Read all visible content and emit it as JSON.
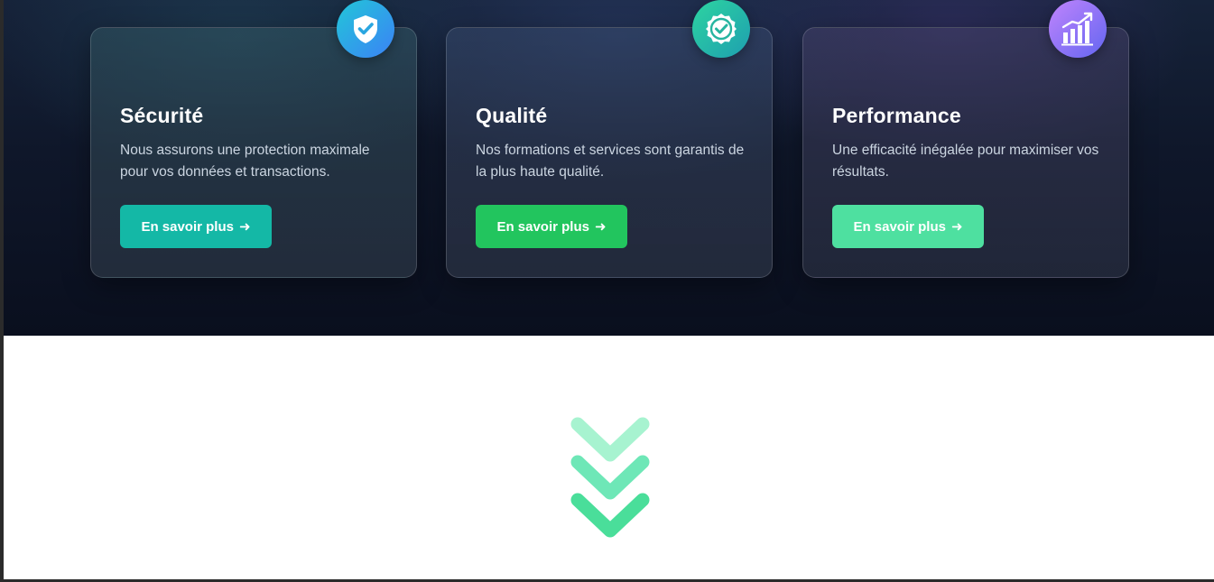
{
  "features": [
    {
      "title": "Sécurité",
      "description": "Nous assurons une protection maximale pour vos données et transactions.",
      "button_label": "En savoir plus",
      "arrow": "➜",
      "icon": "shield-check-icon",
      "button_color": "#14b8a6"
    },
    {
      "title": "Qualité",
      "description": "Nos formations et services sont garantis de la plus haute qualité.",
      "button_label": "En savoir plus",
      "arrow": "➜",
      "icon": "badge-check-icon",
      "button_color": "#22c55e"
    },
    {
      "title": "Performance",
      "description": "Une efficacité inégalée pour maximiser vos résultats.",
      "button_label": "En savoir plus",
      "arrow": "➜",
      "icon": "chart-growth-icon",
      "button_color": "#4ee0a0"
    }
  ],
  "scroll_indicator": {
    "icon": "triple-chevron-down-icon",
    "colors": [
      "#a7f3d0",
      "#6ee7b7",
      "#4ade9a"
    ]
  }
}
